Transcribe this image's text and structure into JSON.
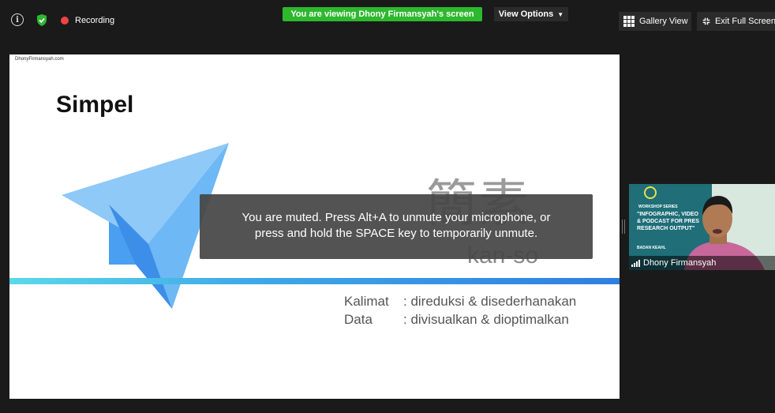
{
  "topbar": {
    "recording_label": "Recording",
    "viewing_banner": "You are viewing Dhony Firmansyah's screen",
    "view_options_label": "View Options",
    "gallery_view_label": "Gallery View",
    "exit_full_screen_label": "Exit Full Screen",
    "icons": [
      "info-icon",
      "shield-icon",
      "record-icon",
      "chevron-down-icon",
      "grid-icon",
      "exit-fullscreen-icon"
    ],
    "colors": {
      "banner": "#2eb82e",
      "record": "#ee4444",
      "shield": "#2eb82e"
    }
  },
  "slide": {
    "site_label": "DhonyFirmansyah.com",
    "title": "Simpel",
    "kanji": "簡素",
    "kanso": "kan-so",
    "lines": [
      {
        "label": "Kalimat",
        "text": ": direduksi & disederhanakan"
      },
      {
        "label": "Data",
        "text": ": divisualkan & dioptimalkan"
      }
    ]
  },
  "toast": {
    "line1": "You are muted. Press Alt+A to unmute your microphone, or",
    "line2": "press and hold the SPACE key to temporarily unmute."
  },
  "video_tile": {
    "participant_name": "Dhony Firmansyah",
    "poster_series": "WORKSHOP SERIES",
    "poster_lines": [
      "\"INFOGRAPHIC, VIDEO",
      "& PODCAST FOR PRES",
      "RESEARCH OUTPUT\""
    ],
    "poster_footer": "BADAN KEAHL"
  }
}
